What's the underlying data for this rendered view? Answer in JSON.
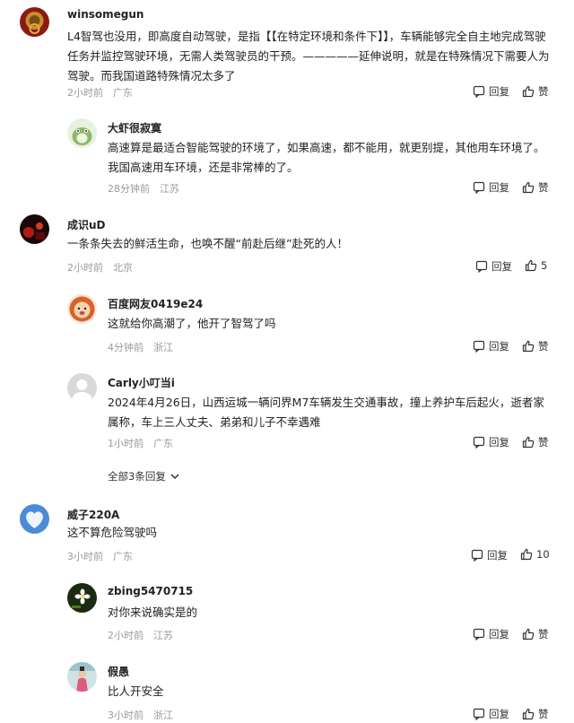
{
  "comments": [
    {
      "username": "winsomegun",
      "text": "L4智驾也没用，即高度自动驾驶，是指【【在特定环境和条件下】】，车辆能够完全自主地完成驾驶任务并监控驾驶环境，无需人类驾驶员的干预。—————延伸说明，就是在特殊情况下需要人为驾驶。而我国道路特殊情况太多了",
      "time": "2小时前",
      "location": "广东",
      "reply_label": "回复",
      "like_label": "赞",
      "avatar": "lion-head-knocker-icon"
    },
    {
      "username": "大虾很寂寞",
      "text": "高速算是最适合智能驾驶的环境了，如果高速，都不能用，就更别提，其他用车环境了。我国高速用车环境，还是非常棒的了。",
      "time": "28分钟前",
      "location": "江苏",
      "reply_label": "回复",
      "like_label": "赞",
      "avatar": "totoro-avatar-icon"
    },
    {
      "username": "成识uD",
      "text": "一条条失去的鲜活生命，也唤不醒“前赴后继”赴死的人！",
      "time": "2小时前",
      "location": "北京",
      "reply_label": "回复",
      "like_label": "5",
      "avatar": "dark-red-photo-icon"
    },
    {
      "username": "百度网友0419e24",
      "text": "这就给你高潮了，他开了智驾了吗",
      "time": "4分钟前",
      "location": "浙江",
      "reply_label": "回复",
      "like_label": "赞",
      "avatar": "lion-cartoon-icon"
    },
    {
      "username": "Carly小叮当i",
      "text": "2024年4月26日，山西运城一辆问界M7车辆发生交通事故，撞上养护车后起火，逝者家属称，车上三人丈夫、弟弟和儿子不幸遇难",
      "time": "1小时前",
      "location": "广东",
      "reply_label": "回复",
      "like_label": "赞",
      "avatar": "default-user-icon"
    },
    {
      "username": "威子220A",
      "text": "这不算危险驾驶吗",
      "time": "3小时前",
      "location": "广东",
      "reply_label": "回复",
      "like_label": "10",
      "avatar": "heart-cloud-icon"
    },
    {
      "username": "zbing5470715",
      "text": "对你来说确实是的",
      "time": "2小时前",
      "location": "江苏",
      "reply_label": "回复",
      "like_label": "赞",
      "avatar": "flower-photo-icon"
    },
    {
      "username": "假愚",
      "text": "比人开安全",
      "time": "3小时前",
      "location": "浙江",
      "reply_label": "回复",
      "like_label": "赞",
      "avatar": "girl-photo-icon"
    }
  ],
  "expand_replies": "全部3条回复"
}
